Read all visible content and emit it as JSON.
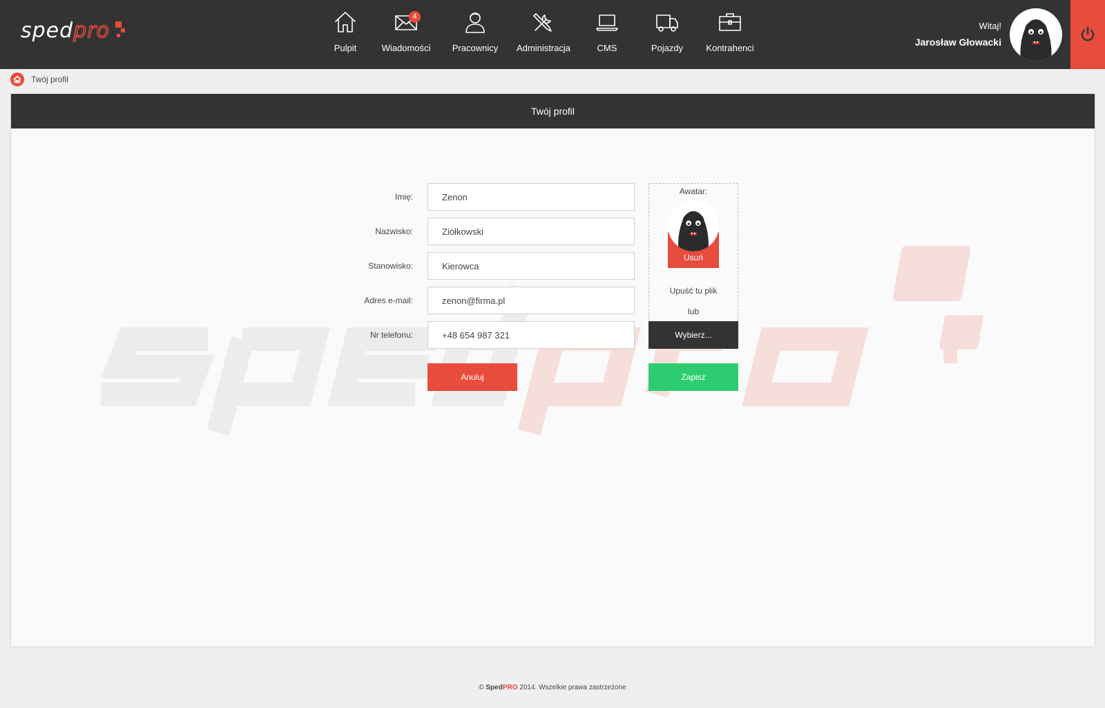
{
  "brand": {
    "logo_part1": "sped",
    "logo_part2": "pro",
    "accent": "#e74c3c",
    "dark": "#333333",
    "success": "#2ecc71"
  },
  "nav": {
    "items": [
      {
        "label": "Pulpit",
        "icon": "home-icon"
      },
      {
        "label": "Wiadomości",
        "icon": "envelope-icon",
        "badge": "4"
      },
      {
        "label": "Pracownicy",
        "icon": "user-icon"
      },
      {
        "label": "Administracja",
        "icon": "tools-icon"
      },
      {
        "label": "CMS",
        "icon": "laptop-icon"
      },
      {
        "label": "Pojazdy",
        "icon": "truck-icon"
      },
      {
        "label": "Kontrahenci",
        "icon": "briefcase-icon"
      }
    ]
  },
  "user": {
    "greeting": "Witaj!",
    "name": "Jarosław Głowacki",
    "avatar_icon": "zombie-avatar-icon"
  },
  "logout": {
    "icon": "power-icon"
  },
  "breadcrumb": {
    "icon": "home-icon",
    "current": "Twój profil"
  },
  "panel": {
    "title": "Twój profil"
  },
  "form": {
    "fields": [
      {
        "label": "Imię:",
        "value": "Zenon"
      },
      {
        "label": "Nazwisko:",
        "value": "Ziółkowski"
      },
      {
        "label": "Stanowisko:",
        "value": "Kierowca"
      },
      {
        "label": "Adres e-mail:",
        "value": "zenon@firma.pl"
      },
      {
        "label": "Nr telefonu:",
        "value": "+48 654 987 321"
      }
    ],
    "cancel_label": "Anuluj",
    "save_label": "Zapisz"
  },
  "avatar": {
    "title": "Awatar:",
    "remove_label": "Usuń",
    "drop_text": "Upuść tu plik",
    "or_text": "lub",
    "choose_label": "Wybierz..."
  },
  "footer": {
    "copyright": "©",
    "brand1": "Sped",
    "brand2": "PRO",
    "text": "2014. Wszelkie prawa zastrzeżone"
  }
}
